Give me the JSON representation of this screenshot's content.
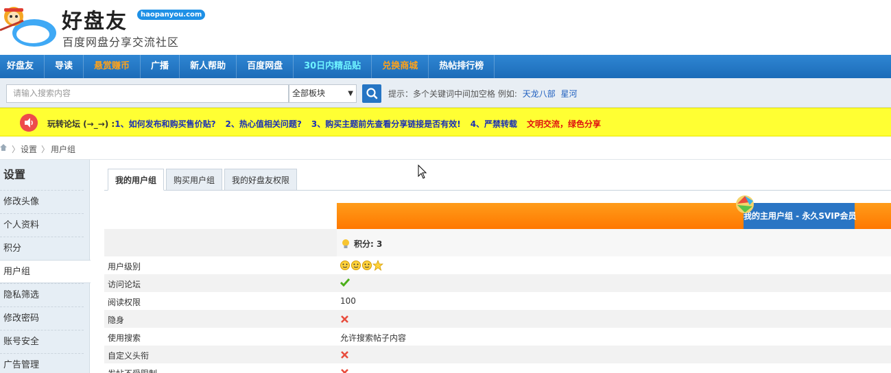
{
  "header": {
    "site_name": "好盘友",
    "domain_badge": "haopanyou.com",
    "slogan": "百度网盘分享交流社区"
  },
  "nav": {
    "items": [
      {
        "label": "好盘友",
        "color": "white"
      },
      {
        "label": "导读",
        "color": "white"
      },
      {
        "label": "悬赏赚币",
        "color": "orange"
      },
      {
        "label": "广播",
        "color": "white"
      },
      {
        "label": "新人帮助",
        "color": "white"
      },
      {
        "label": "百度网盘",
        "color": "white"
      },
      {
        "label": "30日内精品贴",
        "color": "cyan"
      },
      {
        "label": "兑换商城",
        "color": "orange"
      },
      {
        "label": "热帖排行榜",
        "color": "white"
      }
    ]
  },
  "search": {
    "placeholder": "请输入搜索内容",
    "scope_selected": "全部板块",
    "hint_prefix": "提示：多个关键词中间加空格 例如:",
    "hint_examples": [
      "天龙八部",
      "星河"
    ]
  },
  "notice": {
    "prefix": "玩转论坛 (→_→) :",
    "items": [
      "1、如何发布和购买售价贴?",
      "2、热心值相关问题?",
      "3、购买主题前先查看分享链接是否有效!",
      "4、严禁转载"
    ],
    "slogan": "文明交流，绿色分享"
  },
  "breadcrumb": {
    "items": [
      "设置",
      "用户组"
    ]
  },
  "sidebar": {
    "title": "设置",
    "items": [
      {
        "label": "修改头像",
        "active": false
      },
      {
        "label": "个人资料",
        "active": false
      },
      {
        "label": "积分",
        "active": false
      },
      {
        "label": "用户组",
        "active": true
      },
      {
        "label": "隐私筛选",
        "active": false
      },
      {
        "label": "修改密码",
        "active": false
      },
      {
        "label": "账号安全",
        "active": false
      },
      {
        "label": "广告管理",
        "active": false
      }
    ]
  },
  "tabs": {
    "items": [
      {
        "label": "我的用户组",
        "active": true
      },
      {
        "label": "购买用户组",
        "active": false
      },
      {
        "label": "我的好盘友权限",
        "active": false
      }
    ]
  },
  "group": {
    "main_group_label": "我的主用户组 - 永久SVIP会员",
    "points_label": "积分: 3",
    "permissions": [
      {
        "label": "用户级别",
        "value_type": "level",
        "value": ""
      },
      {
        "label": "访问论坛",
        "value_type": "yes",
        "value": ""
      },
      {
        "label": "阅读权限",
        "value_type": "text",
        "value": "100"
      },
      {
        "label": "隐身",
        "value_type": "no",
        "value": ""
      },
      {
        "label": "使用搜索",
        "value_type": "text",
        "value": "允许搜索帖子内容"
      },
      {
        "label": "自定义头衔",
        "value_type": "no",
        "value": ""
      },
      {
        "label": "发帖不受限制",
        "value_type": "no",
        "value": ""
      }
    ]
  },
  "colors": {
    "nav_blue": "#1c6cb8",
    "notice_yellow": "#ffff33",
    "group_orange": "#ff8a00",
    "group_blue": "#2a75c4",
    "yes_green": "#4caf1a",
    "no_red": "#e84c3d"
  }
}
